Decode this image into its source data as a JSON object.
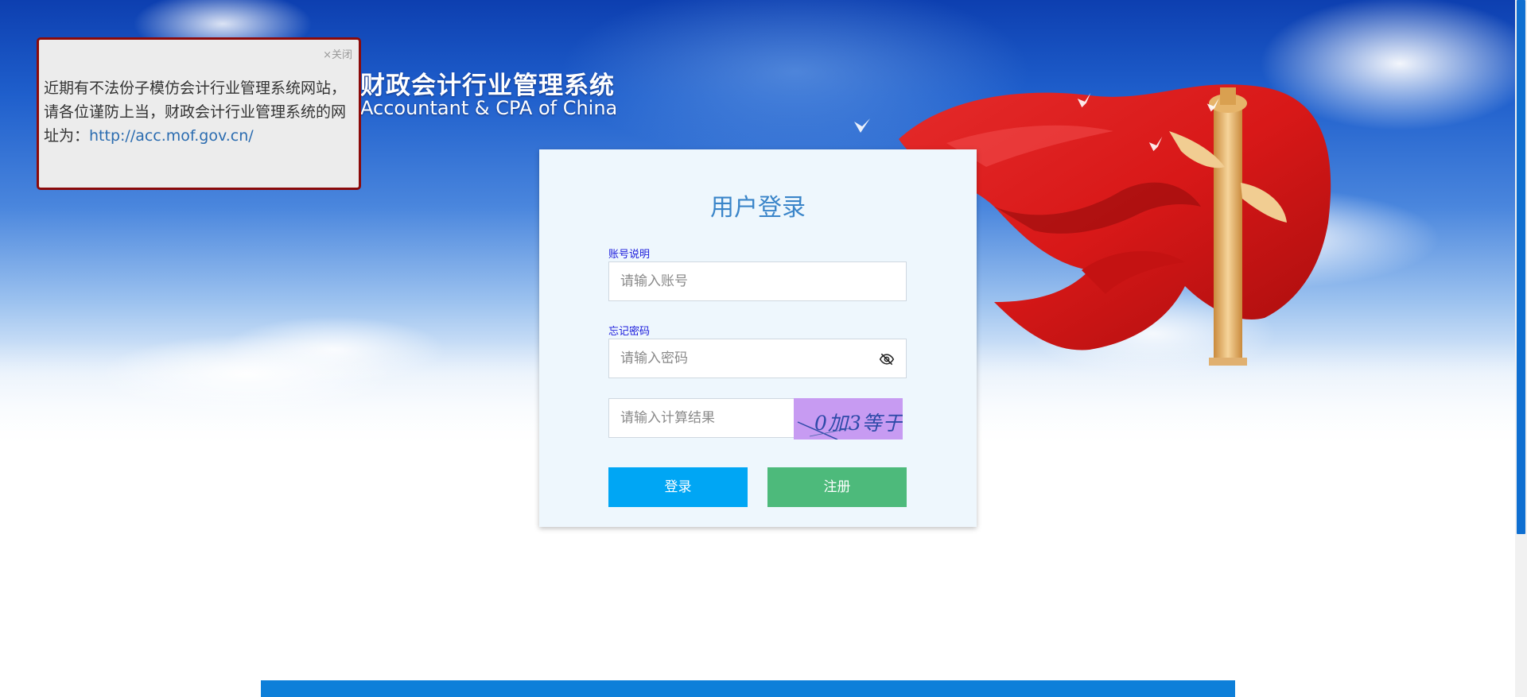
{
  "header": {
    "title": "财政会计行业管理系统",
    "subtitle": "Accountant & CPA of China"
  },
  "notice": {
    "close_label": "×关闭",
    "message": "近期有不法份子模仿会计行业管理系统网站，请各位谨防上当，财政会计行业管理系统的网址为：",
    "link": "http://acc.mof.gov.cn/"
  },
  "login": {
    "title": "用户登录",
    "account_help_link": "账号说明",
    "account_placeholder": "请输入账号",
    "forgot_password_link": "忘记密码",
    "password_placeholder": "请输入密码",
    "captcha_placeholder": "请输入计算结果",
    "captcha_text": "0加3等于",
    "login_button": "登录",
    "register_button": "注册"
  },
  "colors": {
    "primary_button": "#00a6f4",
    "register_button": "#4dba7b",
    "notice_border": "#8b0a0a",
    "footer_bar": "#0d7fd9",
    "title_color": "#3a85c9"
  },
  "icons": {
    "password_toggle": "eye-slash-icon",
    "notice_close": "close-icon"
  }
}
